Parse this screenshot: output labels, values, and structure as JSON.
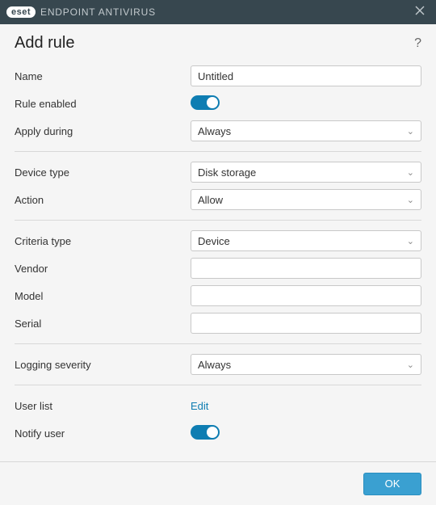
{
  "window": {
    "brand_logo_text": "eset",
    "brand_product": "ENDPOINT ANTIVIRUS"
  },
  "page": {
    "title": "Add rule"
  },
  "fields": {
    "name": {
      "label": "Name",
      "value": "Untitled"
    },
    "rule_enabled": {
      "label": "Rule enabled",
      "value": true
    },
    "apply_during": {
      "label": "Apply during",
      "value": "Always"
    },
    "device_type": {
      "label": "Device type",
      "value": "Disk storage"
    },
    "action": {
      "label": "Action",
      "value": "Allow"
    },
    "criteria_type": {
      "label": "Criteria type",
      "value": "Device"
    },
    "vendor": {
      "label": "Vendor",
      "value": ""
    },
    "model": {
      "label": "Model",
      "value": ""
    },
    "serial": {
      "label": "Serial",
      "value": ""
    },
    "logging_severity": {
      "label": "Logging severity",
      "value": "Always"
    },
    "user_list": {
      "label": "User list",
      "link": "Edit"
    },
    "notify_user": {
      "label": "Notify user",
      "value": true
    }
  },
  "buttons": {
    "ok": "OK"
  },
  "colors": {
    "accent": "#0e7db2",
    "button": "#3aa0d1",
    "titlebar": "#37474f"
  }
}
